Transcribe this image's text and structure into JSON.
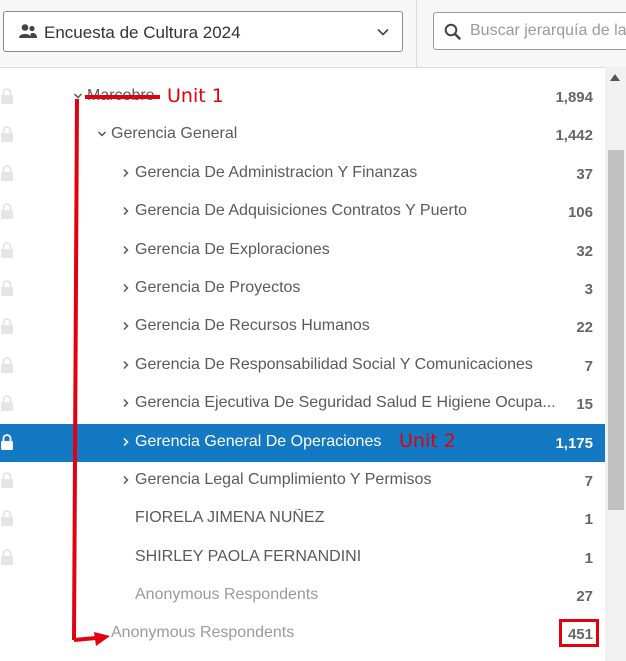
{
  "header": {
    "survey_select": {
      "label": "Encuesta de Cultura 2024",
      "icon": "people-icon"
    },
    "search": {
      "placeholder": "Buscar jerarquía de la",
      "value": ""
    }
  },
  "tree": {
    "rows": [
      {
        "label": "Marcobre",
        "count": "1,894",
        "expanded": true
      },
      {
        "label": "Gerencia General",
        "count": "1,442",
        "expanded": true
      },
      {
        "label": "Gerencia De Administracion Y Finanzas",
        "count": "37"
      },
      {
        "label": "Gerencia De Adquisiciones Contratos Y Puerto",
        "count": "106"
      },
      {
        "label": "Gerencia De Exploraciones",
        "count": "32"
      },
      {
        "label": "Gerencia De Proyectos",
        "count": "3"
      },
      {
        "label": "Gerencia De Recursos Humanos",
        "count": "22"
      },
      {
        "label": "Gerencia De Responsabilidad Social Y Comunicaciones",
        "count": "7"
      },
      {
        "label": "Gerencia Ejecutiva De Seguridad Salud E Higiene Ocupa...",
        "count": "15"
      },
      {
        "label": "Gerencia General De Operaciones",
        "count": "1,175",
        "selected": true
      },
      {
        "label": "Gerencia Legal Cumplimiento Y Permisos",
        "count": "7"
      },
      {
        "label": "FIORELA JIMENA NUÑEZ",
        "count": "1"
      },
      {
        "label": "SHIRLEY PAOLA FERNANDINI",
        "count": "1"
      },
      {
        "label": "Anonymous Respondents",
        "count": "27"
      },
      {
        "label": "Anonymous Respondents",
        "count": "451"
      }
    ]
  },
  "annotations": {
    "unit1": "Unit 1",
    "unit2": "Unit 2",
    "color": "#e3000f"
  },
  "colors": {
    "selected_row": "#1279c2",
    "text": "#5a5a5a",
    "muted_text": "#9a9a9a"
  }
}
